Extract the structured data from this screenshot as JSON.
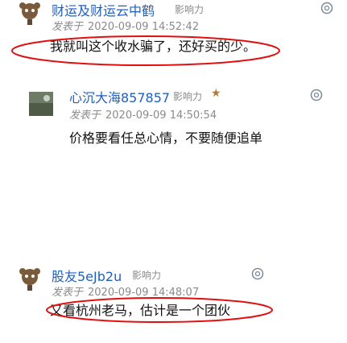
{
  "comments": [
    {
      "username": "财运及财运云中鹤",
      "influence_label": "影响力",
      "meta_label": "发表于",
      "timestamp": "2020-09-09 14:52:42",
      "text": "我就叫这个收水骗了，还好买的少。",
      "icons": {
        "avatar": "animal-avatar-icon",
        "reply": "reply-icon"
      }
    },
    {
      "username": "心沉大海857857",
      "influence_label": "影响力",
      "star": "★",
      "meta_label": "发表于",
      "timestamp": "2020-09-09 14:50:54",
      "text": "价格要看任总心情，不要随便追单",
      "icons": {
        "avatar": "photo-avatar-icon",
        "reply": "reply-icon"
      }
    },
    {
      "username": "股友5eJb2u",
      "influence_label": "影响力",
      "meta_label": "发表于",
      "timestamp": "2020-09-09 14:48:07",
      "text": "又看杭州老马，估计是一个团伙",
      "icons": {
        "avatar": "animal-avatar-icon",
        "reply": "reply-icon"
      }
    }
  ],
  "colors": {
    "username": "#1f5fbf",
    "meta": "#8a8a8a",
    "highlight": "#e01010",
    "reply": "#7a8a9a"
  }
}
